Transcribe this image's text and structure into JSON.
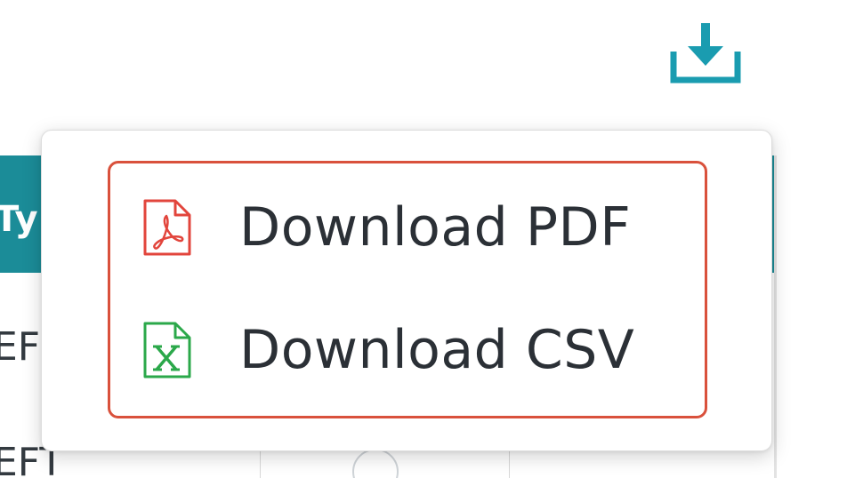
{
  "toolbar": {
    "download_icon": "download-tray-icon",
    "accent_color": "#1a9cb0"
  },
  "background_table": {
    "header_fragment": "Ty",
    "header_color": "#1b8c98",
    "rows": [
      {
        "fragment": "EF"
      },
      {
        "fragment": "EFT"
      }
    ]
  },
  "download_menu": {
    "highlight_color": "#d9513c",
    "items": [
      {
        "label": "Download PDF",
        "icon": "pdf-file-icon",
        "icon_color": "#e2453c"
      },
      {
        "label": "Download CSV",
        "icon": "excel-file-icon",
        "icon_color": "#2ba84a"
      }
    ]
  }
}
